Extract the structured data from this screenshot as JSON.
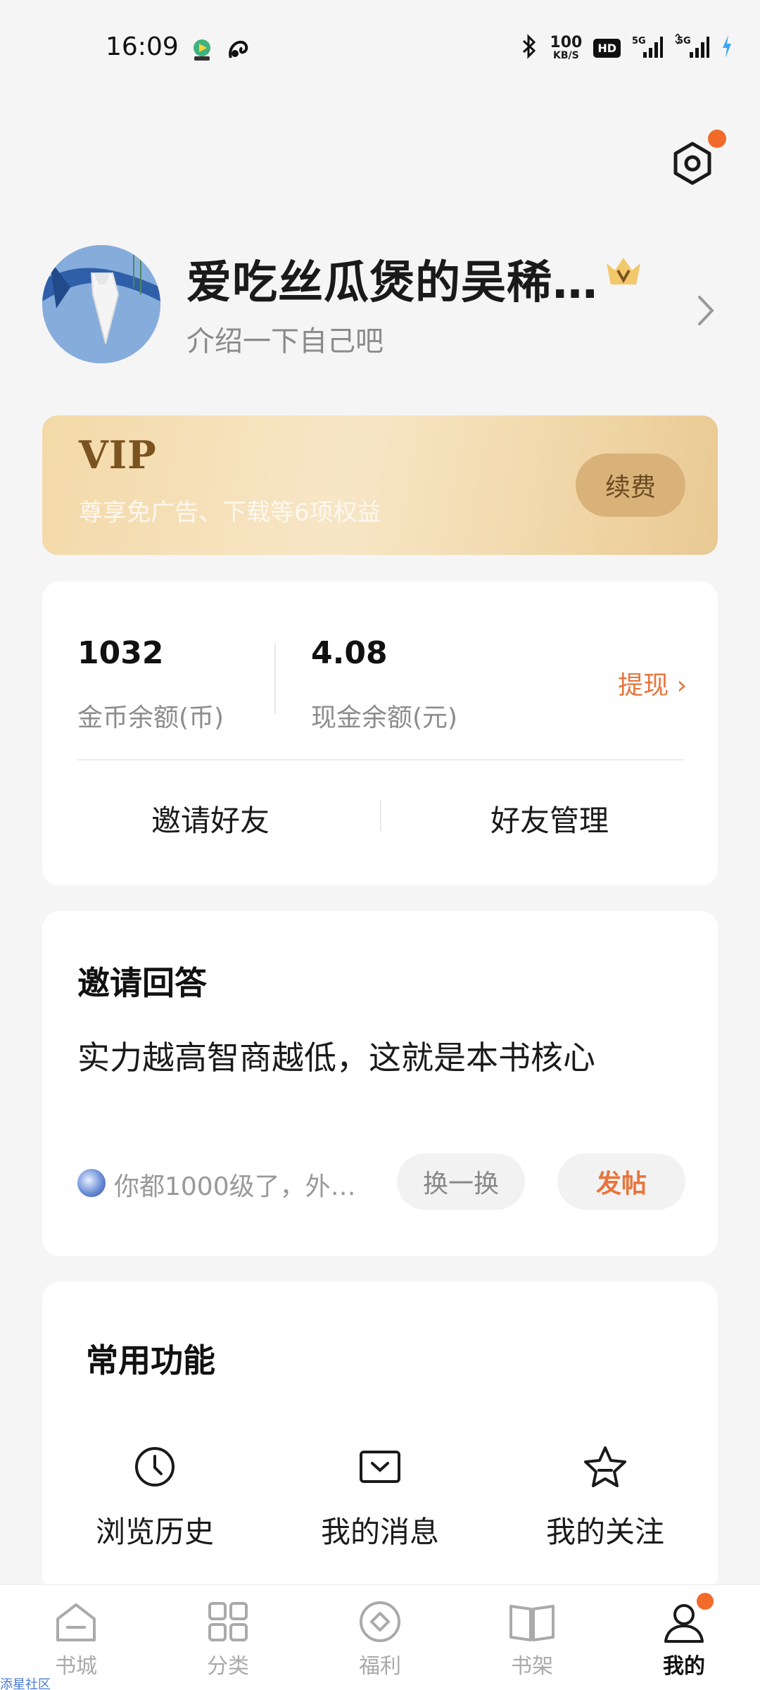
{
  "status_bar": {
    "time": "16:09",
    "net_speed_value": "100",
    "net_speed_unit": "KB/S",
    "hd_label": "HD",
    "signal1_label": "5G",
    "signal2_label": "5G"
  },
  "profile": {
    "username": "爱吃丝瓜煲的吴稀…",
    "bio": "介绍一下自己吧"
  },
  "vip": {
    "title": "VIP",
    "subtitle": "尊享免广告、下载等6项权益",
    "renew_label": "续费"
  },
  "wallet": {
    "coins_value": "1032",
    "coins_label": "金币余额(币)",
    "cash_value": "4.08",
    "cash_label": "现金余额(元)",
    "withdraw_label": "提现 ›",
    "invite_label": "邀请好友",
    "manage_label": "好友管理"
  },
  "qa": {
    "title": "邀请回答",
    "question": "实力越高智商越低，这就是本书核心",
    "preview": "你都1000级了，外…",
    "swap_label": "换一换",
    "post_label": "发帖"
  },
  "functions": {
    "title": "常用功能",
    "items": [
      {
        "label": "浏览历史",
        "icon": "clock-icon"
      },
      {
        "label": "我的消息",
        "icon": "message-icon"
      },
      {
        "label": "我的关注",
        "icon": "star-icon"
      }
    ]
  },
  "nav": {
    "items": [
      {
        "label": "书城",
        "icon": "home-icon"
      },
      {
        "label": "分类",
        "icon": "category-icon"
      },
      {
        "label": "福利",
        "icon": "welfare-icon"
      },
      {
        "label": "书架",
        "icon": "bookshelf-icon"
      },
      {
        "label": "我的",
        "icon": "profile-icon"
      }
    ]
  },
  "watermark": "添星社区",
  "colors": {
    "accent_orange": "#e8743b",
    "badge_dot": "#f26b2a",
    "vip_gold": "#d9b27a"
  }
}
